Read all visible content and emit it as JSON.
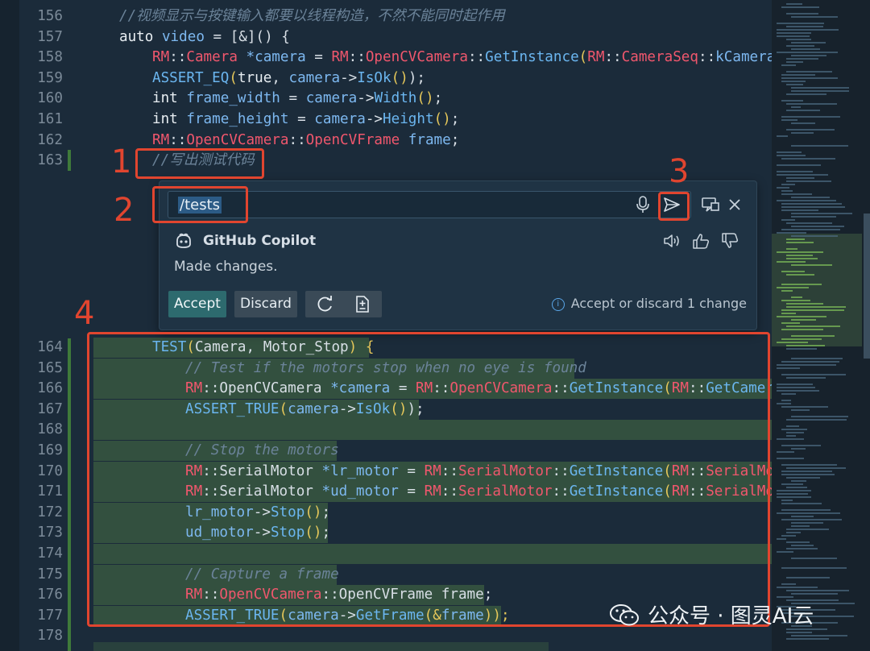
{
  "colors": {
    "accent_red": "#e1452f",
    "accept_bg": "#2d6a6e",
    "diff_bg": "#33503f"
  },
  "editor": {
    "lines_top": [
      {
        "num": "156",
        "tokens": [
          {
            "t": "//视频显示与按键输入都要以线程构造，不然不能同时起作用",
            "c": "cm"
          }
        ],
        "indent": 0
      },
      {
        "num": "157",
        "tokens": [
          {
            "t": "auto ",
            "c": "k"
          },
          {
            "t": "video",
            "c": "var"
          },
          {
            "t": " = [&]() {",
            "c": "plain"
          }
        ],
        "indent": 0
      },
      {
        "num": "158",
        "tokens": [
          {
            "t": "RM",
            "c": "ns"
          },
          {
            "t": "::",
            "c": "plain"
          },
          {
            "t": "Camera ",
            "c": "ns"
          },
          {
            "t": "*camera",
            "c": "var"
          },
          {
            "t": " = ",
            "c": "plain"
          },
          {
            "t": "RM",
            "c": "ns"
          },
          {
            "t": "::",
            "c": "plain"
          },
          {
            "t": "OpenCVCamera",
            "c": "ns"
          },
          {
            "t": "::",
            "c": "plain"
          },
          {
            "t": "GetInstance",
            "c": "fn"
          },
          {
            "t": "(",
            "c": "p"
          },
          {
            "t": "RM",
            "c": "ns"
          },
          {
            "t": "::",
            "c": "plain"
          },
          {
            "t": "CameraSeq",
            "c": "ns"
          },
          {
            "t": "::",
            "c": "plain"
          },
          {
            "t": "kCameraEig",
            "c": "var"
          }
        ],
        "indent": 1
      },
      {
        "num": "159",
        "tokens": [
          {
            "t": "ASSERT_EQ",
            "c": "fn"
          },
          {
            "t": "(",
            "c": "p"
          },
          {
            "t": "true",
            "c": "k"
          },
          {
            "t": ", ",
            "c": "plain"
          },
          {
            "t": "camera",
            "c": "var"
          },
          {
            "t": "->",
            "c": "plain"
          },
          {
            "t": "IsOk",
            "c": "fn"
          },
          {
            "t": "()",
            "c": "p"
          },
          {
            "t": ");",
            "c": "plain"
          }
        ],
        "indent": 1
      },
      {
        "num": "160",
        "tokens": [
          {
            "t": "int ",
            "c": "k"
          },
          {
            "t": "frame_width",
            "c": "var"
          },
          {
            "t": " = ",
            "c": "plain"
          },
          {
            "t": "camera",
            "c": "var"
          },
          {
            "t": "->",
            "c": "plain"
          },
          {
            "t": "Width",
            "c": "fn"
          },
          {
            "t": "()",
            "c": "p"
          },
          {
            "t": ";",
            "c": "plain"
          }
        ],
        "indent": 1
      },
      {
        "num": "161",
        "tokens": [
          {
            "t": "int ",
            "c": "k"
          },
          {
            "t": "frame_height",
            "c": "var"
          },
          {
            "t": " = ",
            "c": "plain"
          },
          {
            "t": "camera",
            "c": "var"
          },
          {
            "t": "->",
            "c": "plain"
          },
          {
            "t": "Height",
            "c": "fn"
          },
          {
            "t": "()",
            "c": "p"
          },
          {
            "t": ";",
            "c": "plain"
          }
        ],
        "indent": 1
      },
      {
        "num": "162",
        "tokens": [
          {
            "t": "RM",
            "c": "ns"
          },
          {
            "t": "::",
            "c": "plain"
          },
          {
            "t": "OpenCVCamera",
            "c": "ns"
          },
          {
            "t": "::",
            "c": "plain"
          },
          {
            "t": "OpenCVFrame ",
            "c": "ns"
          },
          {
            "t": "frame",
            "c": "var"
          },
          {
            "t": ";",
            "c": "plain"
          }
        ],
        "indent": 1
      },
      {
        "num": "163",
        "tokens": [
          {
            "t": "//写出测试代码",
            "c": "cm"
          }
        ],
        "indent": 1
      }
    ],
    "lines_bottom": [
      {
        "num": "164",
        "tokens": [
          {
            "t": "TEST",
            "c": "fn"
          },
          {
            "t": "(",
            "c": "p"
          },
          {
            "t": "Camera, Motor_Stop",
            "c": "plain"
          },
          {
            "t": ") {",
            "c": "p"
          }
        ],
        "indent": 1
      },
      {
        "num": "165",
        "tokens": [
          {
            "t": "// Test if the motors stop when no eye is found",
            "c": "cm"
          }
        ],
        "indent": 2
      },
      {
        "num": "166",
        "tokens": [
          {
            "t": "RM",
            "c": "ns"
          },
          {
            "t": "::OpenCVCamera ",
            "c": "plain"
          },
          {
            "t": "*camera",
            "c": "var"
          },
          {
            "t": " = ",
            "c": "plain"
          },
          {
            "t": "RM",
            "c": "ns"
          },
          {
            "t": "::",
            "c": "plain"
          },
          {
            "t": "OpenCVCamera",
            "c": "ns"
          },
          {
            "t": "::",
            "c": "plain"
          },
          {
            "t": "GetInstance",
            "c": "fn"
          },
          {
            "t": "(",
            "c": "p"
          },
          {
            "t": "RM",
            "c": "ns"
          },
          {
            "t": "::",
            "c": "plain"
          },
          {
            "t": "GetCameraSe",
            "c": "fn"
          }
        ],
        "indent": 2
      },
      {
        "num": "167",
        "tokens": [
          {
            "t": "ASSERT_TRUE",
            "c": "fn"
          },
          {
            "t": "(",
            "c": "p"
          },
          {
            "t": "camera",
            "c": "var"
          },
          {
            "t": "->",
            "c": "plain"
          },
          {
            "t": "IsOk",
            "c": "fn"
          },
          {
            "t": "()",
            "c": "p"
          },
          {
            "t": ");",
            "c": "plain"
          }
        ],
        "indent": 2
      },
      {
        "num": "168",
        "tokens": [],
        "indent": 2
      },
      {
        "num": "169",
        "tokens": [
          {
            "t": "// Stop the motors",
            "c": "cm"
          }
        ],
        "indent": 2
      },
      {
        "num": "170",
        "tokens": [
          {
            "t": "RM",
            "c": "ns"
          },
          {
            "t": "::SerialMotor ",
            "c": "plain"
          },
          {
            "t": "*lr_motor",
            "c": "var"
          },
          {
            "t": " = ",
            "c": "plain"
          },
          {
            "t": "RM",
            "c": "ns"
          },
          {
            "t": "::",
            "c": "plain"
          },
          {
            "t": "SerialMotor",
            "c": "ns"
          },
          {
            "t": "::",
            "c": "plain"
          },
          {
            "t": "GetInstance",
            "c": "fn"
          },
          {
            "t": "(",
            "c": "p"
          },
          {
            "t": "RM",
            "c": "ns"
          },
          {
            "t": "::",
            "c": "plain"
          },
          {
            "t": "SerialMoto",
            "c": "ns"
          }
        ],
        "indent": 2
      },
      {
        "num": "171",
        "tokens": [
          {
            "t": "RM",
            "c": "ns"
          },
          {
            "t": "::SerialMotor ",
            "c": "plain"
          },
          {
            "t": "*ud_motor",
            "c": "var"
          },
          {
            "t": " = ",
            "c": "plain"
          },
          {
            "t": "RM",
            "c": "ns"
          },
          {
            "t": "::",
            "c": "plain"
          },
          {
            "t": "SerialMotor",
            "c": "ns"
          },
          {
            "t": "::",
            "c": "plain"
          },
          {
            "t": "GetInstance",
            "c": "fn"
          },
          {
            "t": "(",
            "c": "p"
          },
          {
            "t": "RM",
            "c": "ns"
          },
          {
            "t": "::",
            "c": "plain"
          },
          {
            "t": "SerialMoto",
            "c": "ns"
          }
        ],
        "indent": 2
      },
      {
        "num": "172",
        "tokens": [
          {
            "t": "lr_motor",
            "c": "var"
          },
          {
            "t": "->",
            "c": "plain"
          },
          {
            "t": "Stop",
            "c": "fn"
          },
          {
            "t": "()",
            "c": "p"
          },
          {
            "t": ";",
            "c": "plain"
          }
        ],
        "indent": 2
      },
      {
        "num": "173",
        "tokens": [
          {
            "t": "ud_motor",
            "c": "var"
          },
          {
            "t": "->",
            "c": "plain"
          },
          {
            "t": "Stop",
            "c": "fn"
          },
          {
            "t": "()",
            "c": "p"
          },
          {
            "t": ";",
            "c": "plain"
          }
        ],
        "indent": 2
      },
      {
        "num": "174",
        "tokens": [],
        "indent": 2
      },
      {
        "num": "175",
        "tokens": [
          {
            "t": "// Capture a frame",
            "c": "cm"
          }
        ],
        "indent": 2
      },
      {
        "num": "176",
        "tokens": [
          {
            "t": "RM",
            "c": "ns"
          },
          {
            "t": "::",
            "c": "plain"
          },
          {
            "t": "OpenCVCamera",
            "c": "ns"
          },
          {
            "t": "::OpenCVFrame frame;",
            "c": "plain"
          }
        ],
        "indent": 2
      },
      {
        "num": "177",
        "tokens": [
          {
            "t": "ASSERT_TRUE",
            "c": "fn"
          },
          {
            "t": "(",
            "c": "p"
          },
          {
            "t": "camera",
            "c": "var"
          },
          {
            "t": "->",
            "c": "plain"
          },
          {
            "t": "GetFrame",
            "c": "fn"
          },
          {
            "t": "(&",
            "c": "p"
          },
          {
            "t": "frame",
            "c": "var"
          },
          {
            "t": "));",
            "c": "p"
          }
        ],
        "indent": 2
      },
      {
        "num": "178",
        "tokens": [],
        "indent": 2
      }
    ]
  },
  "chat": {
    "input_value": "/tests",
    "assistant_name": "GitHub Copilot",
    "message": "Made changes.",
    "accept_label": "Accept",
    "discard_label": "Discard",
    "hint": "Accept or discard 1 change"
  },
  "annotations": [
    "1",
    "2",
    "3",
    "4"
  ],
  "watermark": "公众号 · 图灵AI云"
}
